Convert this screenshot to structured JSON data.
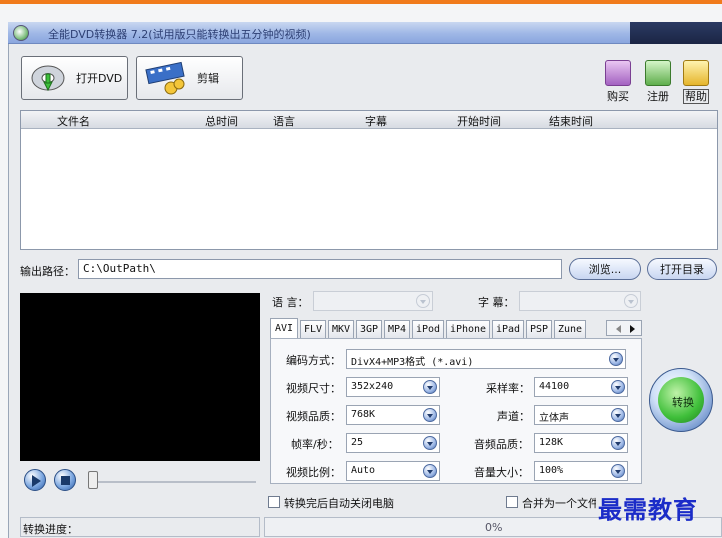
{
  "window": {
    "title": "全能DVD转换器 7.2(试用版只能转换出五分钟的视频)"
  },
  "toolbar": {
    "open_dvd_label": "打开DVD",
    "edit_label": "剪辑"
  },
  "right_icons": {
    "buy_label": "购买",
    "register_label": "注册",
    "help_label": "帮助"
  },
  "file_list": {
    "columns": [
      "文件名",
      "总时间",
      "语言",
      "字幕",
      "开始时间",
      "结束时间"
    ],
    "rows": []
  },
  "output": {
    "label": "输出路径：",
    "path": "C:\\OutPath\\",
    "browse_label": "浏览...",
    "open_dir_label": "打开目录"
  },
  "language": {
    "label": "语 言：",
    "value": ""
  },
  "subtitle": {
    "label": "字 幕：",
    "value": ""
  },
  "format_tabs": [
    "AVI",
    "FLV",
    "MKV",
    "3GP",
    "MP4",
    "iPod",
    "iPhone",
    "iPad",
    "PSP",
    "Zune"
  ],
  "active_tab": "AVI",
  "settings": {
    "encode_label": "编码方式：",
    "encode_value": "DivX4+MP3格式 (*.avi)",
    "size_label": "视频尺寸：",
    "size_value": "352x240",
    "sample_label": "采样率：",
    "sample_value": "44100",
    "quality_label": "视频品质：",
    "quality_value": "768K",
    "channel_label": "声道：",
    "channel_value": "立体声",
    "fps_label": "帧率/秒：",
    "fps_value": "25",
    "audio_quality_label": "音频品质：",
    "audio_quality_value": "128K",
    "ratio_label": "视频比例：",
    "ratio_value": "Auto",
    "volume_label": "音量大小：",
    "volume_value": "100%"
  },
  "convert_label": "转换",
  "options": {
    "shutdown_label": "转换完后自动关闭电脑",
    "merge_label": "合并为一个文件"
  },
  "status": {
    "progress_label": "转换进度：",
    "progress_value": "0%"
  },
  "watermark": "最需教育",
  "colors": {
    "accent_orange": "#f07a1c",
    "titlebar_blue": "#9fb7e6",
    "go_green": "#3fbf3a"
  }
}
